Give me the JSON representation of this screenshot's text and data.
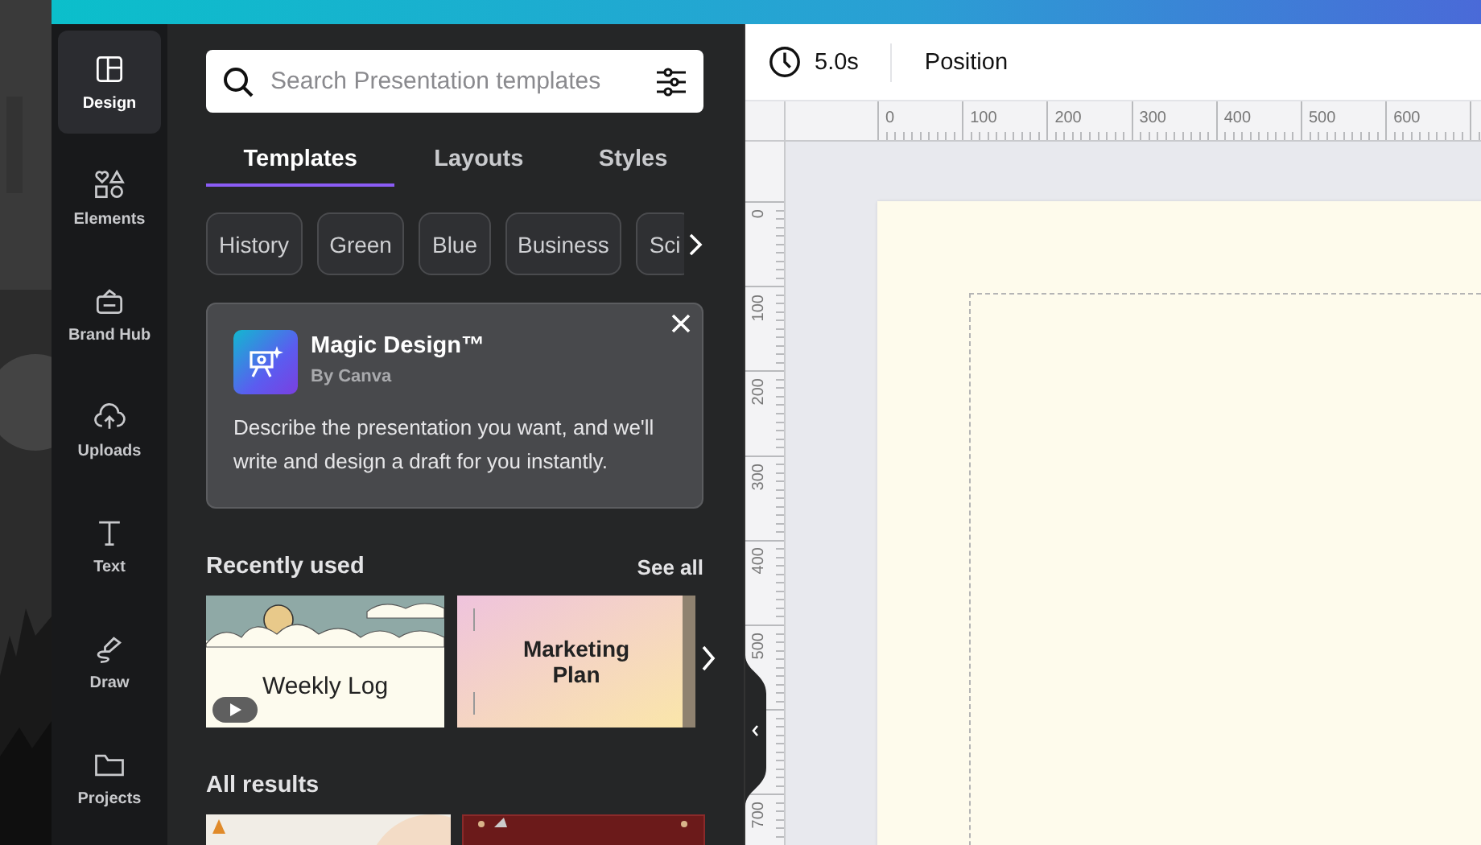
{
  "sidebar": {
    "items": [
      {
        "label": "Design",
        "selected": true
      },
      {
        "label": "Elements",
        "selected": false
      },
      {
        "label": "Brand Hub",
        "selected": false
      },
      {
        "label": "Uploads",
        "selected": false
      },
      {
        "label": "Text",
        "selected": false
      },
      {
        "label": "Draw",
        "selected": false
      },
      {
        "label": "Projects",
        "selected": false
      }
    ]
  },
  "panel": {
    "search": {
      "placeholder": "Search Presentation templates"
    },
    "tabs": [
      {
        "label": "Templates",
        "selected": true
      },
      {
        "label": "Layouts",
        "selected": false
      },
      {
        "label": "Styles",
        "selected": false
      }
    ],
    "chips": [
      "History",
      "Green",
      "Blue",
      "Business",
      "Sci"
    ],
    "promo": {
      "title": "Magic Design™",
      "subtitle": "By Canva",
      "description": "Describe the presentation you want, and we'll write and design a draft for you instantly."
    },
    "recently_used": {
      "heading": "Recently used",
      "link": "See all",
      "templates": [
        {
          "title": "Weekly Log",
          "kind": "clouds",
          "video": true
        },
        {
          "title": "Marketing Plan",
          "kind": "gradient",
          "video": false
        }
      ]
    },
    "all_results": {
      "heading": "All results",
      "templates": [
        {
          "kind": "light"
        },
        {
          "kind": "dark"
        }
      ]
    }
  },
  "toolbar": {
    "duration": "5.0s",
    "position": "Position"
  },
  "rulers": {
    "horizontal": [
      "0",
      "100",
      "200",
      "300",
      "400",
      "500",
      "600"
    ],
    "vertical_above_handle": [
      "0",
      "100",
      "200",
      "300",
      "400",
      "500"
    ],
    "vertical_below_handle": [
      "700"
    ]
  }
}
